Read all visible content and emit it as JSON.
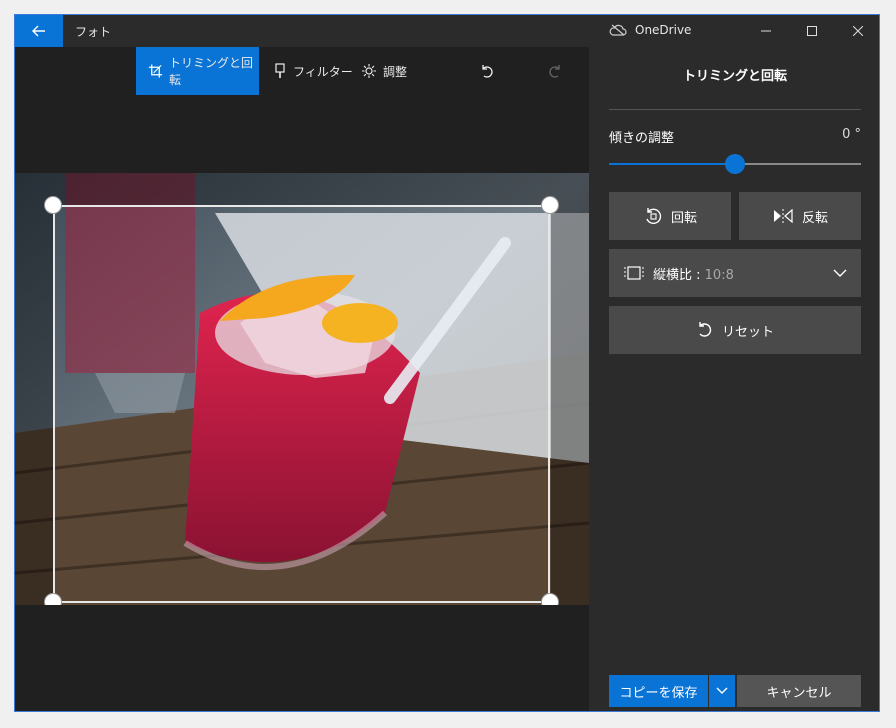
{
  "window": {
    "app_title": "フォト",
    "onedrive_label": "OneDrive"
  },
  "toolbar": {
    "crop_label": "トリミングと回転",
    "filter_label": "フィルター",
    "adjust_label": "調整"
  },
  "panel": {
    "title": "トリミングと回転",
    "tilt_label": "傾きの調整",
    "tilt_value": "0 °",
    "tilt_slider_fraction": 0.5,
    "rotate_label": "回転",
    "flip_label": "反転",
    "aspect_label": "縦横比 : ",
    "aspect_value": "10:8",
    "reset_label": "リセット",
    "save_label": "コピーを保存",
    "cancel_label": "キャンセル"
  },
  "colors": {
    "accent": "#0a74d6",
    "window_bg": "#202020",
    "panel_bg": "#2b2b2b",
    "button_bg": "#4a4a4a"
  }
}
